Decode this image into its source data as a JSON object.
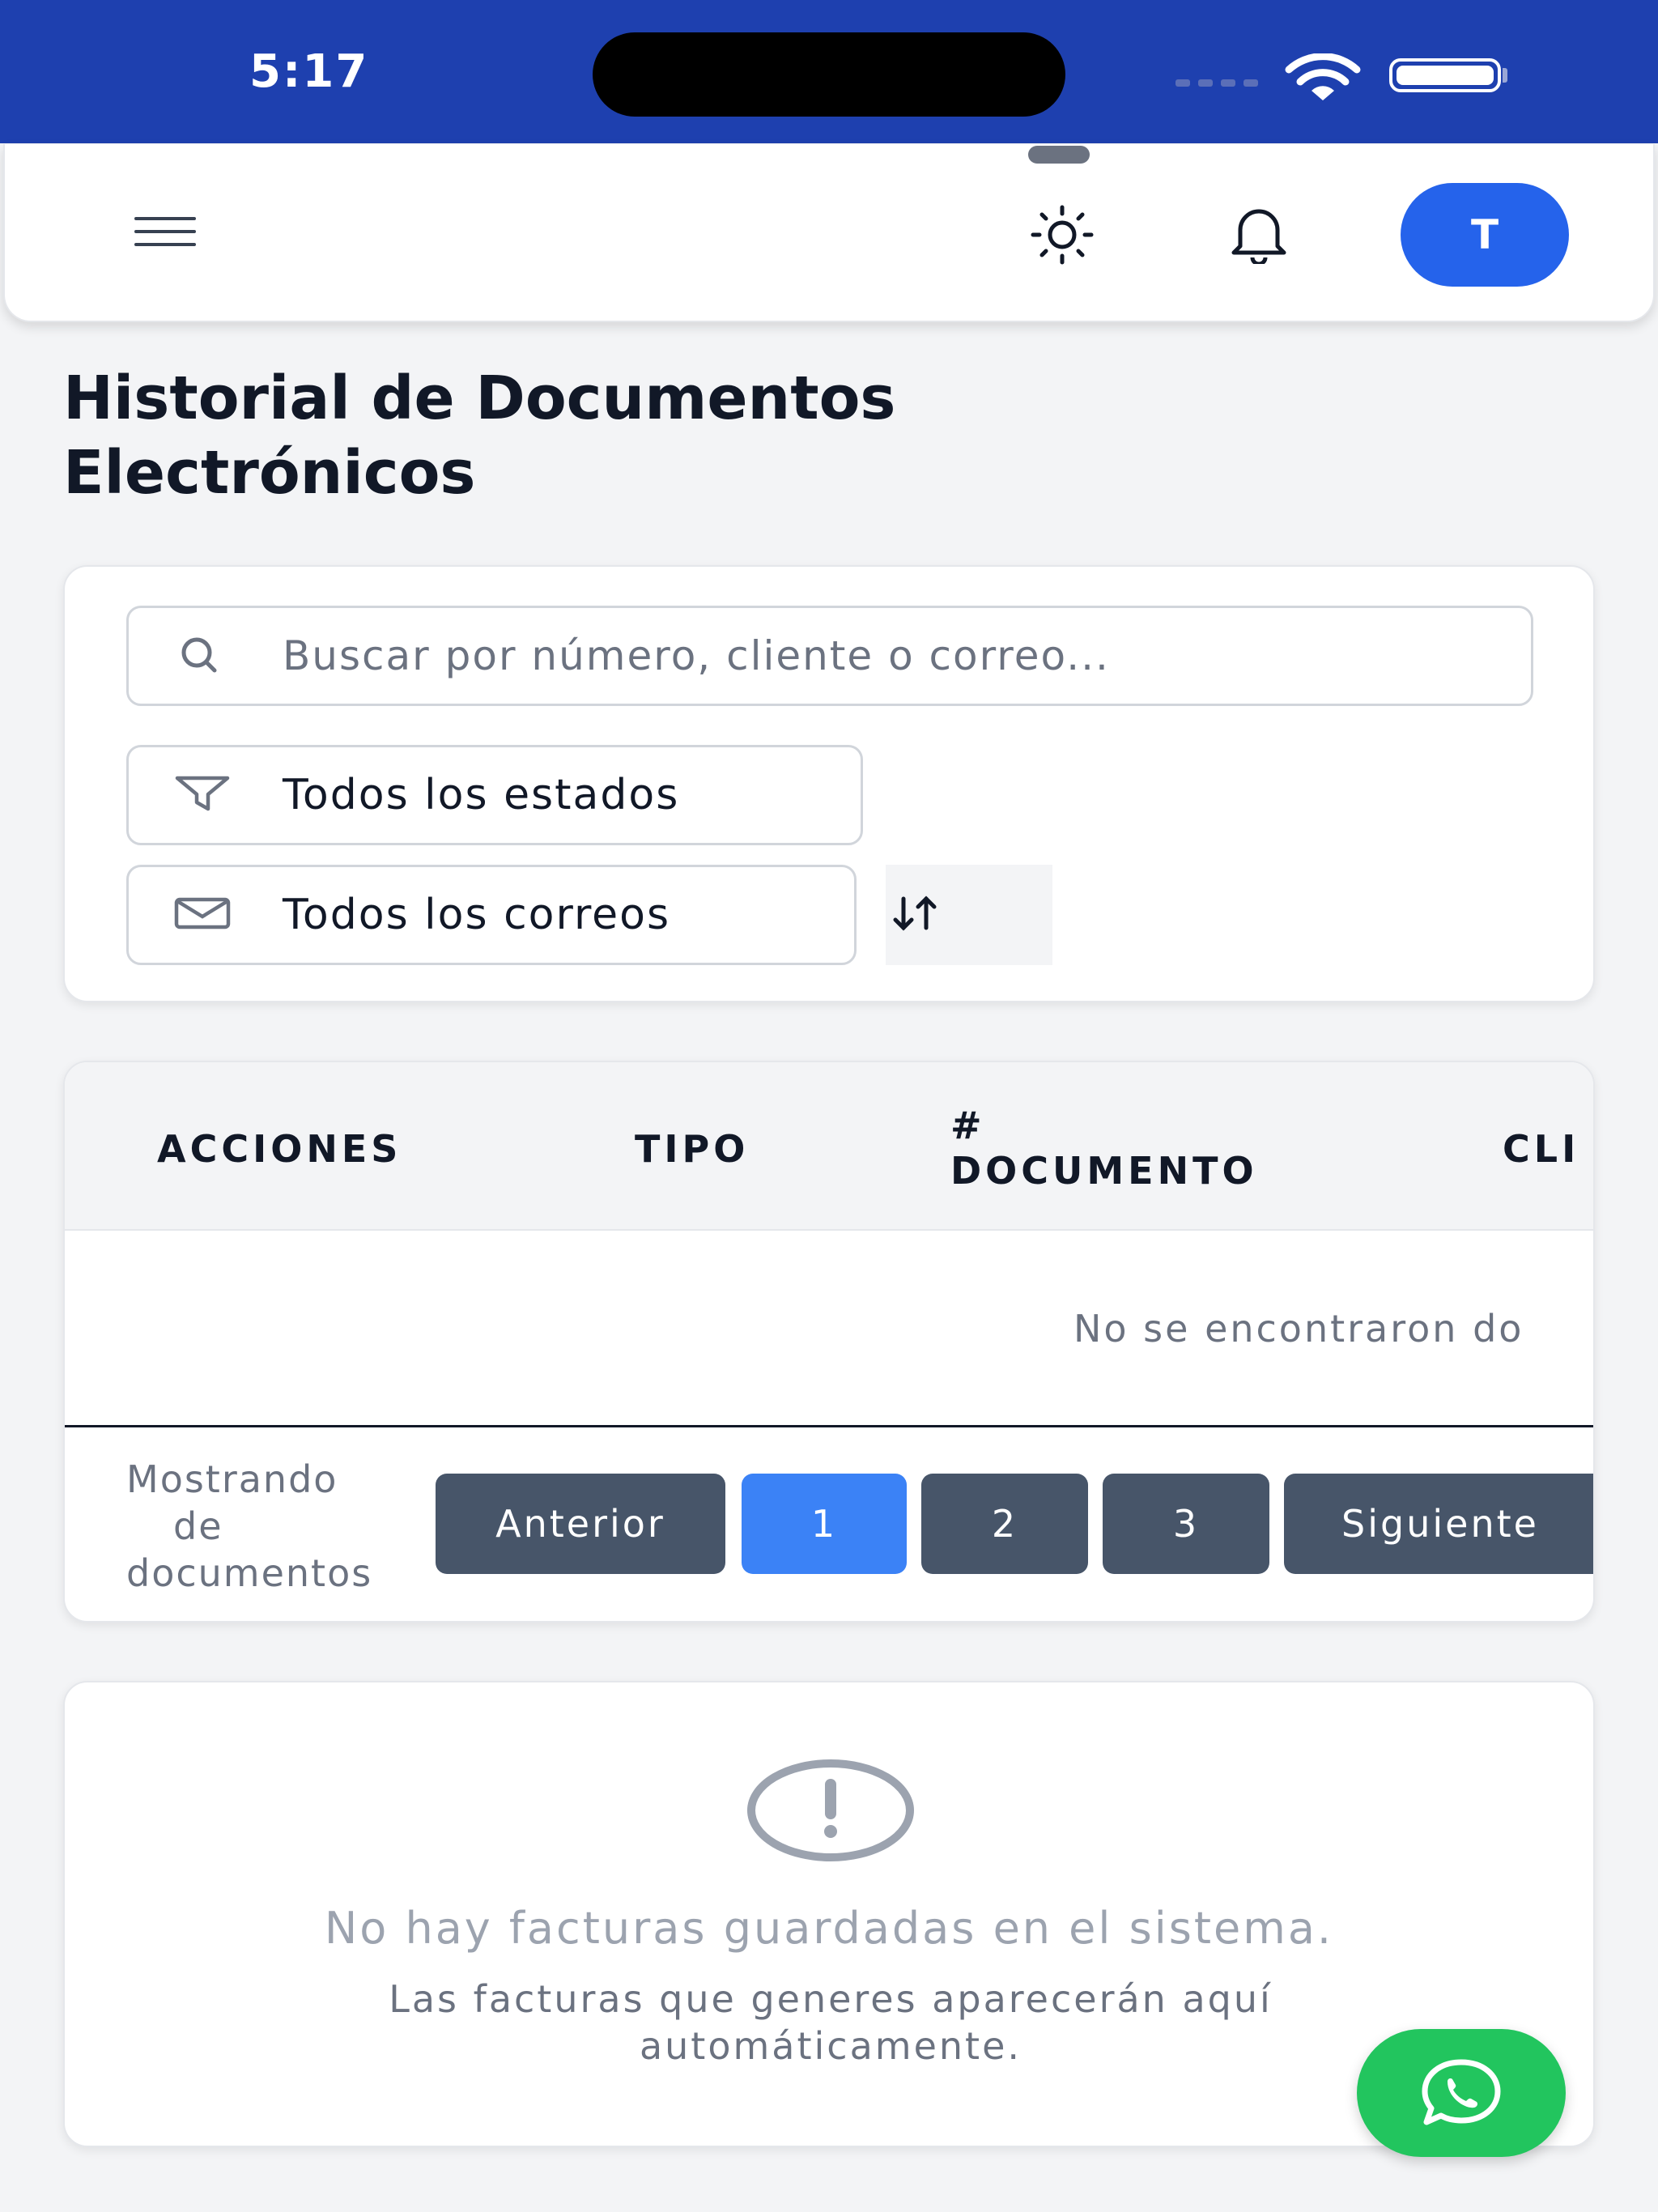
{
  "status_bar": {
    "time": "5:17",
    "icons": [
      "signal-icon",
      "wifi-icon",
      "battery-icon"
    ]
  },
  "header": {
    "menu_icon": "hamburger-menu-icon",
    "theme_icon": "sun-icon",
    "notifications_icon": "bell-icon",
    "avatar_initial": "T",
    "avatar_color": "#2563eb"
  },
  "page": {
    "title_line1": "Historial de Documentos",
    "title_line2": "Electrónicos"
  },
  "filters": {
    "search_placeholder": "Buscar por número, cliente o correo...",
    "search_value": "",
    "status_select": "Todos los estados",
    "email_select": "Todos los correos",
    "sort_label": "↓↑"
  },
  "table": {
    "columns": [
      "ACCIONES",
      "TIPO",
      "#",
      "DOCUMENTO",
      "CLI"
    ],
    "empty_message": "No se encontraron do",
    "pagination": {
      "info": "Mostrando de documentos",
      "info_line1": "Mostrando",
      "info_line2": "de",
      "info_line3": "documentos",
      "previous": "Anterior",
      "pages": [
        "1",
        "2",
        "3"
      ],
      "current_page": "1",
      "next": "Siguiente"
    }
  },
  "empty_state": {
    "icon": "alert-circle-icon",
    "title": "No hay facturas guardadas en el sistema.",
    "subtitle": "Las facturas que generes aparecerán aquí automáticamente."
  },
  "fab": {
    "icon": "whatsapp-icon",
    "color": "#22c55e"
  },
  "colors": {
    "status_bar": "#1e40af",
    "primary": "#3b82f6",
    "pagination_button": "#475569",
    "background": "#f3f4f6"
  }
}
